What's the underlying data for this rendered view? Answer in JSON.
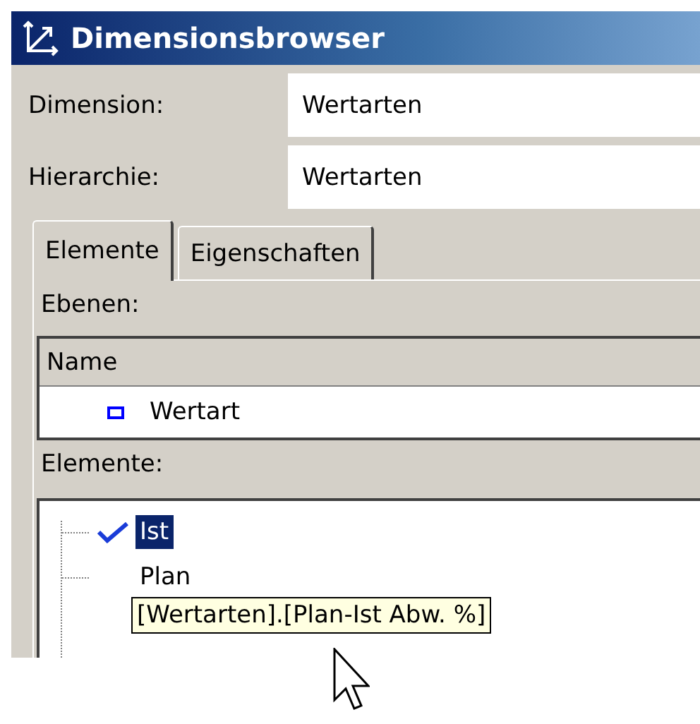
{
  "window": {
    "title": "Dimensionsbrowser"
  },
  "fields": [
    {
      "label": "Dimension:",
      "value": "Wertarten"
    },
    {
      "label": "Hierarchie:",
      "value": "Wertarten"
    }
  ],
  "tabs": [
    {
      "label": "Elemente",
      "selected": true
    },
    {
      "label": "Eigenschaften",
      "selected": false
    }
  ],
  "levels": {
    "label": "Ebenen:",
    "columns": [
      "Name"
    ],
    "rows": [
      {
        "name": "Wertart"
      }
    ]
  },
  "elements": {
    "label": "Elemente:",
    "items": [
      {
        "label": "Ist",
        "checked": true,
        "selected": true
      },
      {
        "label": "Plan",
        "checked": false,
        "selected": false
      }
    ]
  },
  "tooltip": {
    "text": "[Wertarten].[Plan-Ist Abw. %]"
  }
}
